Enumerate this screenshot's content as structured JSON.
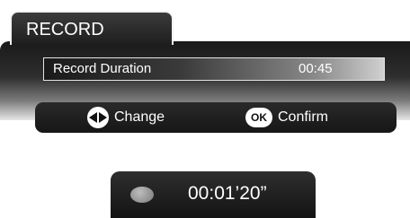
{
  "menu": {
    "title": "RECORD",
    "row": {
      "label": "Record Duration",
      "value": "00:45"
    }
  },
  "help_bar": {
    "change": {
      "icon": "left-right-arrow-icon",
      "label": "Change"
    },
    "confirm": {
      "icon": "ok-button-icon",
      "icon_text": "OK",
      "label": "Confirm"
    }
  },
  "status": {
    "icon": "record-indicator-icon",
    "elapsed": "00:01’20”"
  }
}
